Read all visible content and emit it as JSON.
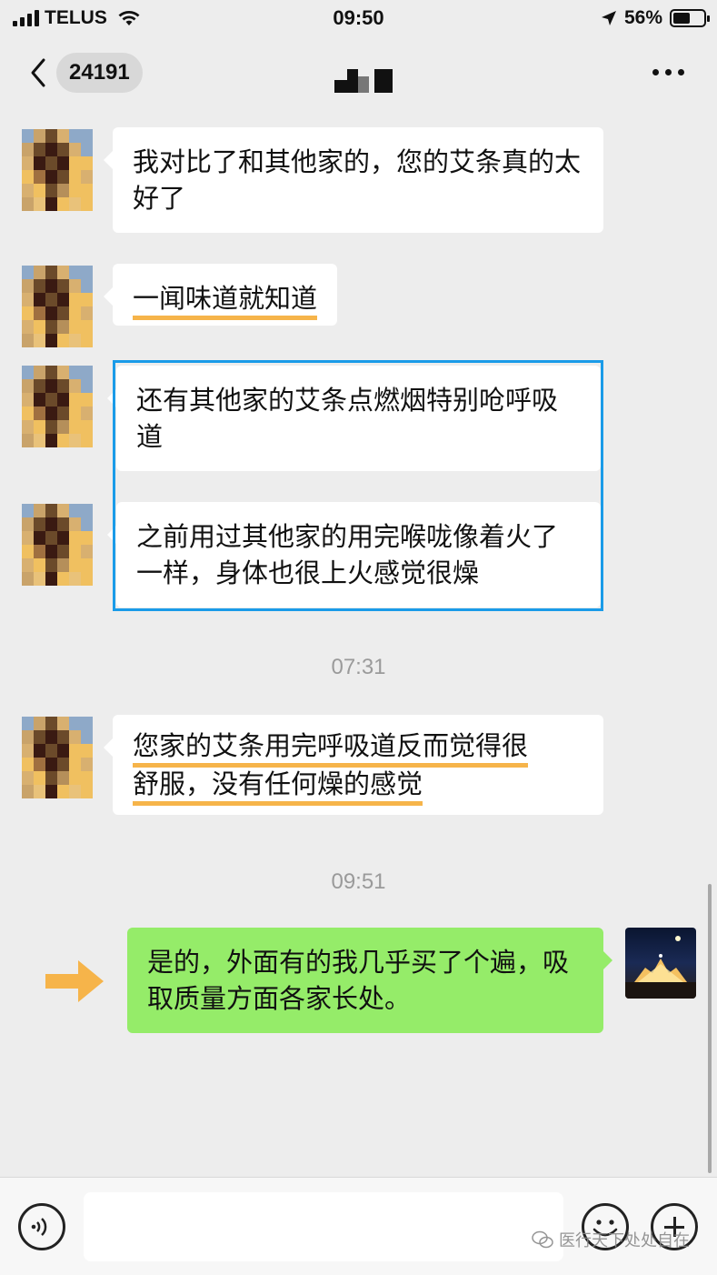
{
  "status_bar": {
    "carrier": "TELUS",
    "time": "09:50",
    "battery_percent": "56%",
    "battery_level": 0.56,
    "icons": [
      "signal-icon",
      "wifi-icon",
      "location-icon",
      "battery-icon"
    ]
  },
  "nav": {
    "unread_count": "24191",
    "icons": [
      "back-icon",
      "more-icon"
    ]
  },
  "messages": [
    {
      "sender": "contact",
      "text": "我对比了和其他家的，您的艾条真的太好了"
    },
    {
      "sender": "contact",
      "text": "一闻味道就知道",
      "underlined": true
    },
    {
      "sender": "contact",
      "text": "还有其他家的艾条点燃烟特别呛呼吸道",
      "highlighted": true
    },
    {
      "sender": "contact",
      "text": "之前用过其他家的用完喉咙像着火了一样，身体也很上火感觉很燥",
      "highlighted": true
    }
  ],
  "timestamp_1": "07:31",
  "message_after_ts1": {
    "sender": "contact",
    "line1": "您家的艾条用完呼吸道反而觉得很",
    "line2": "舒服，没有任何燥的感觉",
    "underlined": true
  },
  "timestamp_2": "09:51",
  "self_message": {
    "sender": "self",
    "text": "是的，外面有的我几乎买了个遍，吸取质量方面各家长处。"
  },
  "watermark": "医行天下处处自在",
  "colors": {
    "background": "#ededed",
    "self_bubble": "#95ec69",
    "contact_bubble": "#ffffff",
    "underline": "#f6b44a",
    "highlight_border": "#1a9be8",
    "arrow": "#f6b44a"
  }
}
